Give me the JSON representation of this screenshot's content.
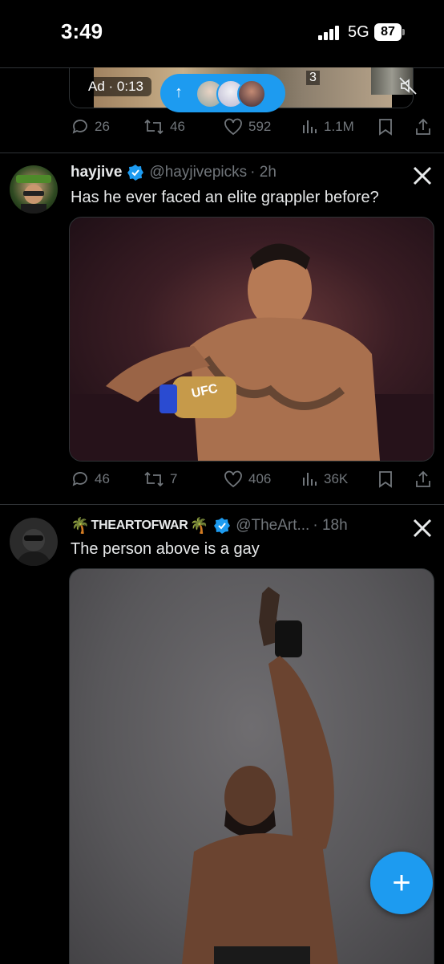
{
  "status_bar": {
    "time": "3:49",
    "network": "5G",
    "battery": "87"
  },
  "ad": {
    "label": "Ad · 0:13",
    "media_count": "3"
  },
  "ad_actions": {
    "replies": "26",
    "reposts": "46",
    "likes": "592",
    "views": "1.1M"
  },
  "post1": {
    "name": "hayjive",
    "handle": "@hayjivepicks",
    "time": "· 2h",
    "text": "Has he ever faced an elite grappler before?",
    "media_caption": "UFC",
    "actions": {
      "replies": "46",
      "reposts": "7",
      "likes": "406",
      "views": "36K"
    }
  },
  "post2": {
    "name": "THEARTOFWAR",
    "name_emoji_left": "🌴",
    "name_emoji_right": "🌴",
    "handle": "@TheArt...",
    "time": "· 18h",
    "text": "The person above is a gay"
  },
  "fab": {
    "label": "+"
  },
  "colors": {
    "accent": "#1d9bf0",
    "muted": "#71767b",
    "text": "#e7e9ea",
    "background": "#000000",
    "divider": "#2f3336"
  }
}
